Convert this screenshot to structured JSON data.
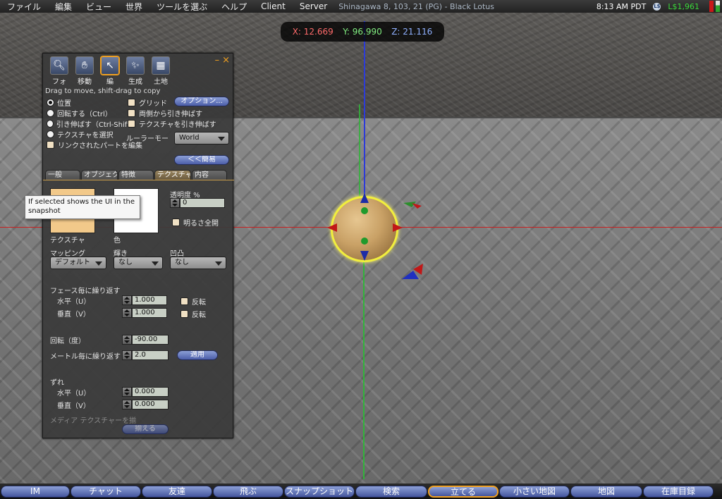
{
  "menubar": {
    "items": [
      "ファイル",
      "編集",
      "ビュー",
      "世界",
      "ツールを選ぶ",
      "ヘルプ",
      "Client",
      "Server"
    ],
    "region": "Shinagawa 8, 103, 21 (PG) - Black Lotus",
    "clock": "8:13 AM PDT",
    "currency_symbol": "L$",
    "balance": "L$1,961"
  },
  "coords": {
    "x": "X: 12.669",
    "y": "Y: 96.990",
    "z": "Z: 21.116"
  },
  "tools": {
    "minimize": "–",
    "close": "×",
    "buttons": [
      {
        "label": "フォ",
        "icon": "magnify-icon"
      },
      {
        "label": "移動",
        "icon": "hand-icon"
      },
      {
        "label": "編",
        "icon": "edit-cursor-icon"
      },
      {
        "label": "生成",
        "icon": "wand-icon"
      },
      {
        "label": "土地",
        "icon": "land-icon"
      }
    ],
    "hint": "Drag to move, shift-drag to copy",
    "modes": [
      "位置",
      "回転する（Ctrl）",
      "引き伸ばす（Ctrl-Shift）",
      "テクスチャを選択"
    ],
    "link_edit": "リンクされたパートを編集",
    "grid": "グリッド",
    "stretch_both": "両側から引き伸ばす",
    "stretch_texture": "テクスチャを引き伸ばす",
    "options_button": "オプション...",
    "ruler_label": "ルーラーモード",
    "ruler_value": "World",
    "simple_button": "＜＜簡易",
    "tabs": [
      "一般",
      "オブジェクト",
      "特徴",
      "テクスチャ",
      "内容"
    ],
    "tooltip": "If selected shows the UI in the snapshot"
  },
  "texture": {
    "texture_label": "テクスチャ",
    "color_label": "色",
    "transparency_label": "透明度 %",
    "transparency_value": "0",
    "full_bright": "明るさ全開",
    "mapping_label": "マッピング",
    "mapping_value": "デフォルト",
    "shiny_label": "輝き",
    "shiny_value": "なし",
    "bump_label": "凹凸",
    "bump_value": "なし",
    "repeats_label": "フェース毎に繰り返す",
    "horiz_label": "水平（U）",
    "horiz_value": "1.000",
    "vert_label": "垂直（V）",
    "vert_value": "1.000",
    "flip": "反転",
    "rotation_label": "回転（度）",
    "rotation_value": "-90.00",
    "per_meter_label": "メートル毎に繰り返す",
    "per_meter_value": "2.0",
    "apply_button": "適用",
    "offset_label": "ずれ",
    "off_horiz_label": "水平（U）",
    "off_horiz_value": "0.000",
    "off_vert_label": "垂直（V）",
    "off_vert_value": "0.000",
    "media_label": "メディア テクスチャーを揃",
    "align_button": "揃える"
  },
  "bottombar": {
    "buttons": [
      "IM",
      "チャット",
      "友達",
      "飛ぶ",
      "スナップショット",
      "検索",
      "立てる",
      "小さい地図",
      "地図",
      "在庫目録"
    ],
    "active": "立てる"
  },
  "colors": {
    "accent": "#f0a020",
    "balance": "#3bd83b",
    "texture_swatch": "#f2c98a",
    "color_swatch": "#ffffff"
  }
}
